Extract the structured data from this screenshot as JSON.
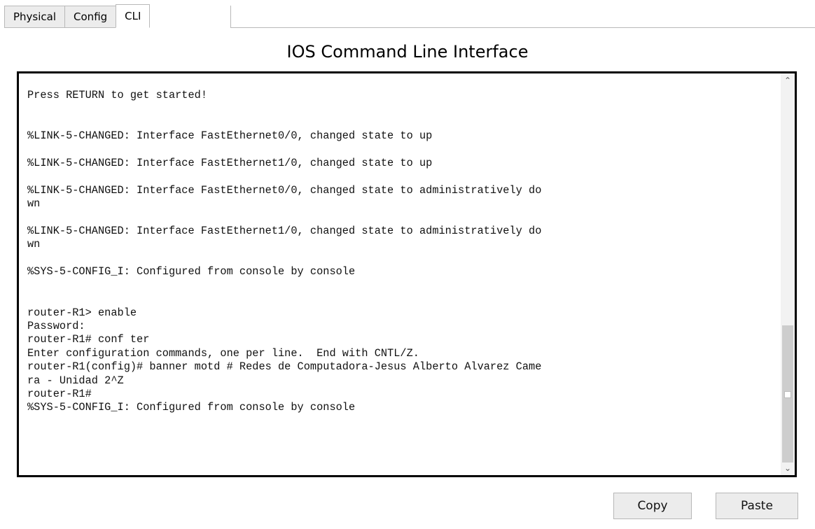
{
  "tabs": [
    {
      "label": "Physical",
      "active": false
    },
    {
      "label": "Config",
      "active": false
    },
    {
      "label": "CLI",
      "active": true
    }
  ],
  "title": "IOS Command Line Interface",
  "console": {
    "lines": [
      "Press RETURN to get started!",
      "",
      "",
      "%LINK-5-CHANGED: Interface FastEthernet0/0, changed state to up",
      "",
      "%LINK-5-CHANGED: Interface FastEthernet1/0, changed state to up",
      "",
      "%LINK-5-CHANGED: Interface FastEthernet0/0, changed state to administratively do",
      "wn",
      "",
      "%LINK-5-CHANGED: Interface FastEthernet1/0, changed state to administratively do",
      "wn",
      "",
      "%SYS-5-CONFIG_I: Configured from console by console",
      "",
      "",
      "router-R1> enable",
      "Password:",
      "router-R1# conf ter",
      "Enter configuration commands, one per line.  End with CNTL/Z.",
      "router-R1(config)# banner motd # Redes de Computadora-Jesus Alberto Alvarez Came",
      "ra - Unidad 2^Z",
      "router-R1#",
      "%SYS-5-CONFIG_I: Configured from console by console"
    ]
  },
  "buttons": {
    "copy": "Copy",
    "paste": "Paste"
  },
  "icons": {
    "scroll_up": "chevron-up-icon",
    "scroll_down": "chevron-down-icon"
  }
}
